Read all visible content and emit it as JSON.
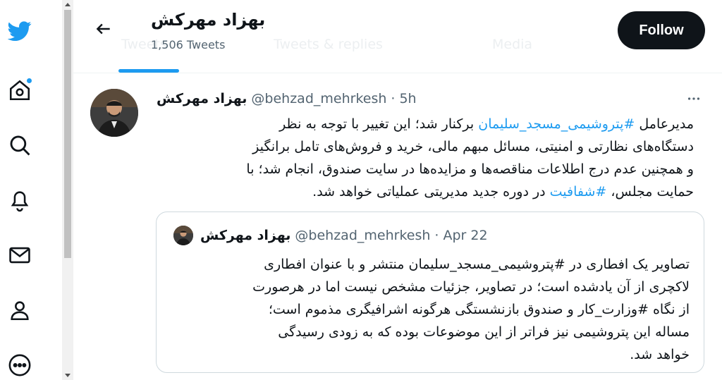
{
  "header": {
    "profile_name": "بهزاد مهرکش",
    "tweet_count": "1,506 Tweets",
    "follow_label": "Follow",
    "tabs": [
      "Tweets",
      "Tweets & replies",
      "Media"
    ]
  },
  "sidebar": {
    "icons": [
      "twitter-logo-icon",
      "home-icon",
      "search-icon",
      "bell-icon",
      "mail-icon",
      "profile-icon",
      "more-icon"
    ]
  },
  "tweet": {
    "author": "بهزاد مهرکش",
    "handle": "@behzad_mehrkesh",
    "separator": "·",
    "time": "5h",
    "lines": [
      {
        "pre": "مدیرعامل ",
        "tag": "#پتروشیمی_مسجد_سلیمان",
        "post": " برکنار شد؛ این تغییر با توجه به نظر"
      },
      {
        "text": "دستگاه‌های نظارتی و امنیتی، مسائل مبهم مالی، خرید و فروش‌های تامل برانگیز"
      },
      {
        "text": "و همچنین عدم درج اطلاعات مناقصه‌ها و مزایده‌ها در سایت صندوق، انجام شد؛ با"
      },
      {
        "pre": "حمایت مجلس، ",
        "tag": "#شفافیت",
        "post": " در دوره جدید مدیریتی عملیاتی خواهد شد."
      }
    ]
  },
  "quote": {
    "author": "بهزاد مهرکش",
    "handle": "@behzad_mehrkesh",
    "separator": "·",
    "time": "Apr 22",
    "lines": [
      "تصاویر یک افطاری در #پتروشیمی_مسجد_سلیمان منتشر و با عنوان افطاری",
      "لاکچری از آن یادشده است؛ در تصاویر، جزئیات مشخص نیست اما در هرصورت",
      "از نگاه #وزارت_کار و صندوق بازنشستگی هرگونه اشرافیگری مذموم است؛",
      "مساله این پتروشیمی نیز فراتر از این موضوعات بوده که به زودی رسیدگی",
      "خواهد شد."
    ]
  },
  "colors": {
    "accent": "#1d9bf0",
    "text": "#0f1419",
    "secondary": "#536471",
    "border": "#cfd9de"
  }
}
